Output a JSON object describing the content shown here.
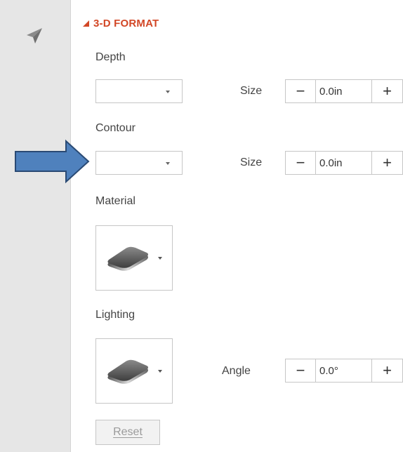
{
  "panel": {
    "section_title": "3-D FORMAT",
    "depth": {
      "label": "Depth",
      "size_label": "Size",
      "size_value": "0.0in"
    },
    "contour": {
      "label": "Contour",
      "size_label": "Size",
      "size_value": "0.0in"
    },
    "material": {
      "label": "Material"
    },
    "lighting": {
      "label": "Lighting",
      "angle_label": "Angle",
      "angle_value": "0.0°"
    },
    "reset_label": "Reset",
    "spinner_minus": "−",
    "spinner_plus": "+"
  },
  "icons": {
    "rail": "paper-plane-icon",
    "pointer": "blue-arrow-annotation"
  },
  "colors": {
    "accent": "#d24726",
    "rail_bg": "#e6e6e6",
    "arrow_fill": "#4f81bd",
    "arrow_stroke": "#2a4a74",
    "border": "#c6c6c6"
  }
}
